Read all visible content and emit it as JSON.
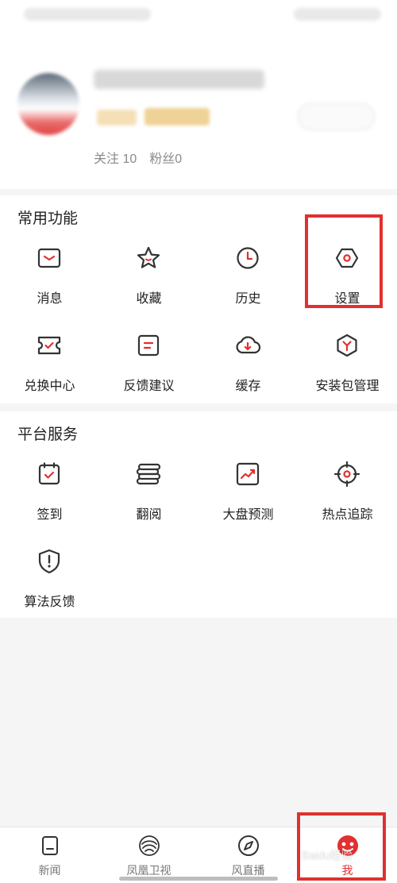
{
  "profile": {
    "follow_label": "关注",
    "follow_count": "10",
    "fans_label": "粉丝",
    "fans_count": "0"
  },
  "common_section": {
    "title": "常用功能",
    "items": [
      {
        "label": "消息",
        "icon": "message-icon"
      },
      {
        "label": "收藏",
        "icon": "favorite-star-icon"
      },
      {
        "label": "历史",
        "icon": "history-clock-icon"
      },
      {
        "label": "设置",
        "icon": "settings-icon"
      },
      {
        "label": "兑换中心",
        "icon": "exchange-ticket-icon"
      },
      {
        "label": "反馈建议",
        "icon": "feedback-icon"
      },
      {
        "label": "缓存",
        "icon": "cloud-download-icon"
      },
      {
        "label": "安装包管理",
        "icon": "package-icon"
      }
    ]
  },
  "platform_section": {
    "title": "平台服务",
    "items": [
      {
        "label": "签到",
        "icon": "check-in-icon"
      },
      {
        "label": "翻阅",
        "icon": "page-flip-icon"
      },
      {
        "label": "大盘预测",
        "icon": "market-chart-icon"
      },
      {
        "label": "热点追踪",
        "icon": "target-icon"
      },
      {
        "label": "算法反馈",
        "icon": "shield-alert-icon"
      }
    ]
  },
  "bottom_nav": [
    {
      "label": "新闻",
      "icon": "news-icon"
    },
    {
      "label": "凤凰卫视",
      "icon": "phoenix-tv-icon"
    },
    {
      "label": "风直播",
      "icon": "live-compass-icon"
    },
    {
      "label": "我",
      "icon": "me-avatar-icon"
    }
  ],
  "watermark": "Baidu经验",
  "colors": {
    "accent": "#e22f2f",
    "icon_stroke": "#333333"
  }
}
